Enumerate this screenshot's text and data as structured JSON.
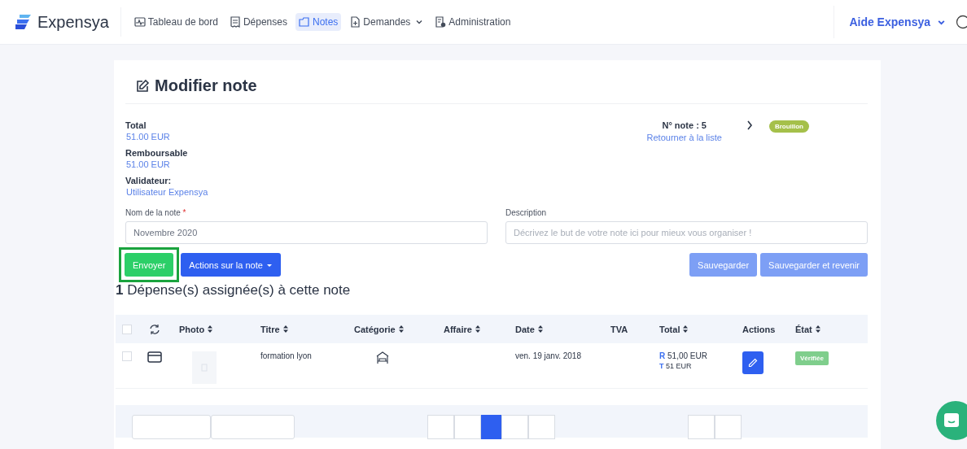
{
  "brand": "Expensya",
  "nav": [
    {
      "label": "Tableau de bord",
      "selected": false,
      "dropdown": false
    },
    {
      "label": "Dépenses",
      "selected": false,
      "dropdown": false
    },
    {
      "label": "Notes",
      "selected": true,
      "dropdown": false
    },
    {
      "label": "Demandes",
      "selected": false,
      "dropdown": true
    },
    {
      "label": "Administration",
      "selected": false,
      "dropdown": false
    }
  ],
  "help_menu": "Aide Expensya",
  "page_title": "Modifier note",
  "summary": [
    {
      "label": "Total",
      "value": "51.00 EUR"
    },
    {
      "label": "Remboursable",
      "value": "51.00 EUR"
    },
    {
      "label": "Validateur:",
      "value": "Utilisateur Expensya"
    }
  ],
  "note_number": "N° note : 5",
  "back_link": "Retourner à la liste",
  "status_badge": "Brouillon",
  "name_field": {
    "label": "Nom de la note",
    "required_mark": "*",
    "value": "Novembre 2020"
  },
  "description_field": {
    "label": "Description",
    "placeholder": "Décrivez le but de votre note ici pour mieux vous organiser !"
  },
  "buttons": [
    {
      "label": "Envoyer",
      "kind": "send",
      "highlighted": true
    },
    {
      "label": "Actions sur la note",
      "kind": "menu",
      "highlighted": false
    },
    {
      "label": "Sauvegarder",
      "kind": "save",
      "highlighted": false
    },
    {
      "label": "Sauvegarder et revenir",
      "kind": "save",
      "highlighted": false
    }
  ],
  "expenses_heading": {
    "count": "1",
    "text": "Dépense(s) assignée(s) à cette note"
  },
  "table": {
    "select_all_checked": false,
    "columns": [
      {
        "label": "Photo",
        "sortable": true
      },
      {
        "label": "Titre",
        "sortable": true
      },
      {
        "label": "Catégorie",
        "sortable": true
      },
      {
        "label": "Affaire",
        "sortable": true
      },
      {
        "label": "Date",
        "sortable": true
      },
      {
        "label": "TVA",
        "sortable": false
      },
      {
        "label": "Total",
        "sortable": true
      },
      {
        "label": "Actions",
        "sortable": false
      },
      {
        "label": "État",
        "sortable": true
      }
    ],
    "rows": [
      {
        "checked": false,
        "title": "formation lyon",
        "date": "ven. 19 janv. 2018",
        "total_r_label": "R",
        "total_r": "51,00 EUR",
        "total_t_label": "T",
        "total_t": "51 EUR",
        "status": "Vérifiée"
      }
    ]
  }
}
